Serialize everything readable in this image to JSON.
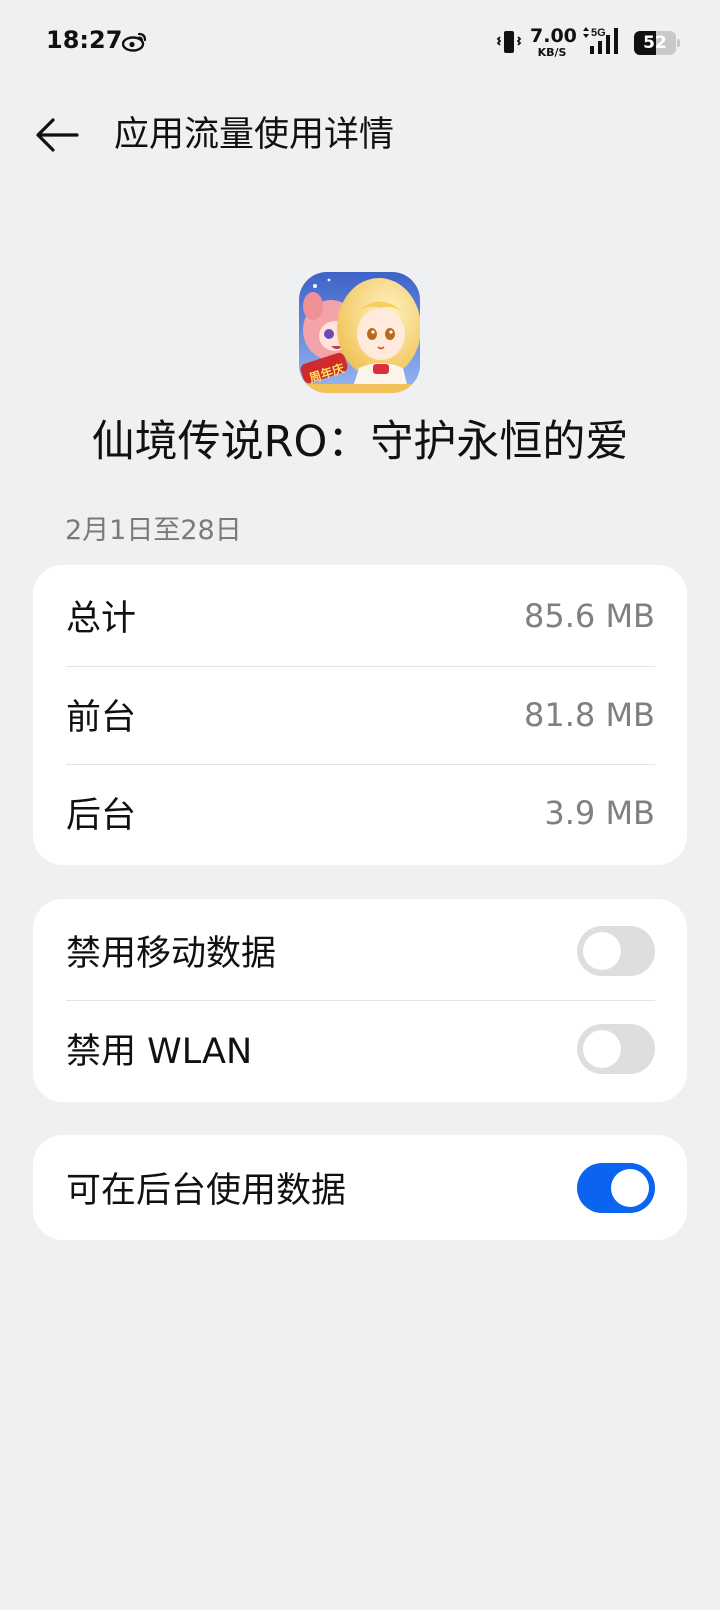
{
  "status_bar": {
    "time": "18:27",
    "net_speed_value": "7.00",
    "net_speed_unit": "KB/S",
    "network_type": "5G",
    "battery_level": 52,
    "battery_text": "52",
    "icons": [
      "weibo-icon",
      "vibrate-icon",
      "signal-icon",
      "battery-icon"
    ]
  },
  "header": {
    "title": "应用流量使用详情"
  },
  "app": {
    "name": "仙境传说RO：守护永恒的爱",
    "icon_badge": "周年庆"
  },
  "date_range": "2月1日至28日",
  "usage": [
    {
      "label": "总计",
      "value": "85.6 MB"
    },
    {
      "label": "前台",
      "value": "81.8 MB"
    },
    {
      "label": "后台",
      "value": "3.9 MB"
    }
  ],
  "toggles": [
    {
      "label": "禁用移动数据",
      "on": false
    },
    {
      "label": "禁用 WLAN",
      "on": false
    }
  ],
  "background_data": {
    "label": "可在后台使用数据",
    "on": true
  },
  "colors": {
    "background": "#eff0f2",
    "accent": "#0a64f0",
    "toggle_off": "#dedee1",
    "secondary_text": "#808080"
  }
}
